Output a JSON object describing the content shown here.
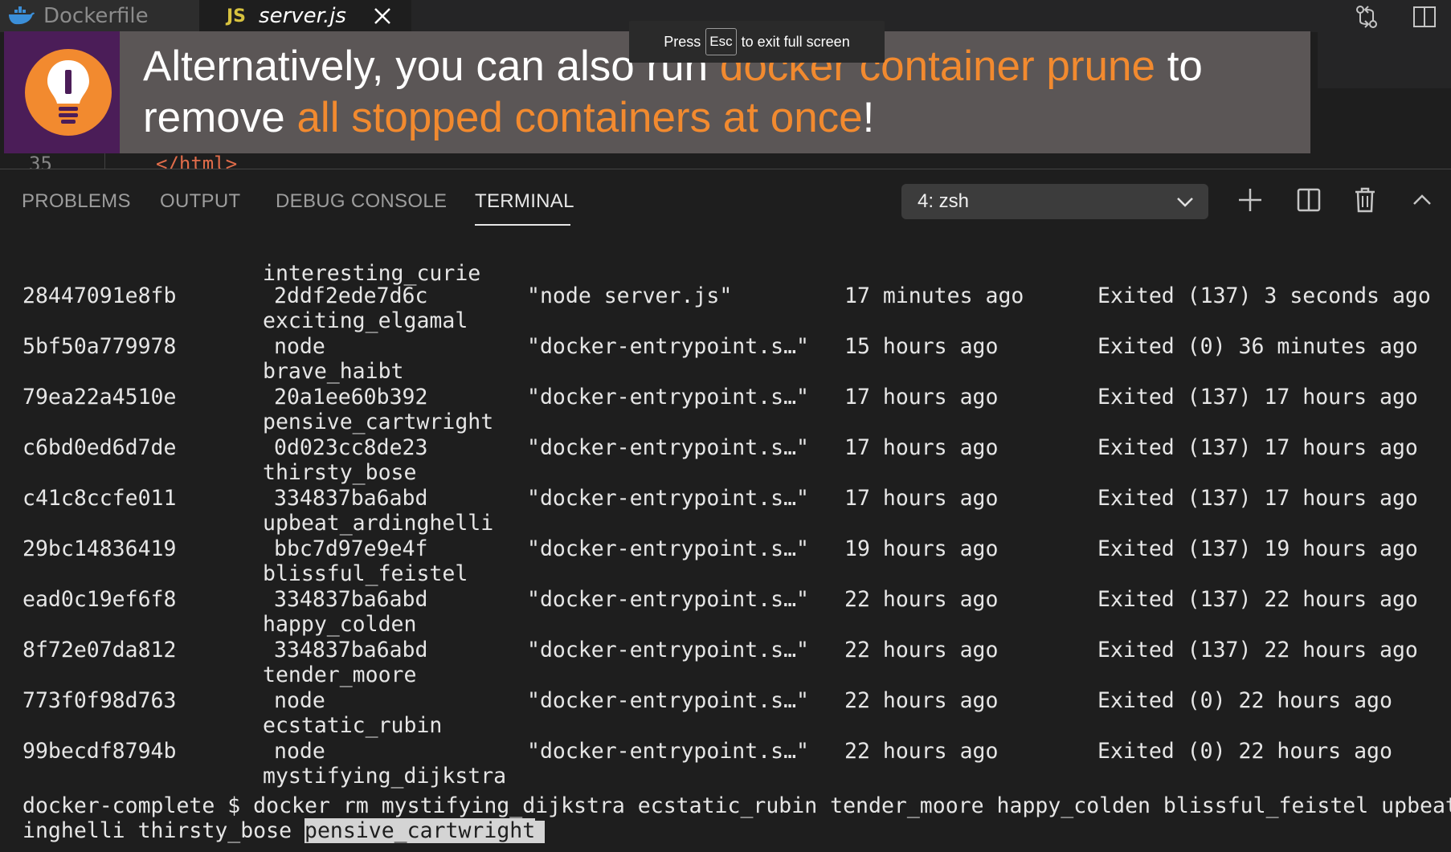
{
  "tabs": [
    {
      "label": "Dockerfile",
      "icon": "docker-whale-icon"
    },
    {
      "label": "server.js",
      "badge": "JS",
      "icon": "javascript-icon"
    }
  ],
  "editor": {
    "line_number": "35",
    "code": "</html>"
  },
  "banner": {
    "icon": "lightbulb-icon",
    "t1": "Alternatively, you can also run ",
    "h1": "docker container prune",
    "t2": " to remove ",
    "h2": "all stopped containers at once",
    "t3": "!"
  },
  "fullscreen_hint": {
    "before": "Press",
    "key": "Esc",
    "after": "to exit full screen"
  },
  "panel": {
    "tabs": [
      "PROBLEMS",
      "OUTPUT",
      "DEBUG CONSOLE",
      "TERMINAL"
    ],
    "active_tab": "TERMINAL",
    "terminal_select": "4: zsh"
  },
  "terminal": {
    "first_name": "interesting_curie",
    "rows": [
      {
        "id": "28447091e8fb",
        "image": "2ddf2ede7d6c",
        "command": "\"node server.js\"",
        "created": "17 minutes ago",
        "status": "Exited (137) 3 seconds ago",
        "name": "exciting_elgamal"
      },
      {
        "id": "5bf50a779978",
        "image": "node",
        "command": "\"docker-entrypoint.s…\"",
        "created": "15 hours ago",
        "status": "Exited (0) 36 minutes ago",
        "name": "brave_haibt"
      },
      {
        "id": "79ea22a4510e",
        "image": "20a1ee60b392",
        "command": "\"docker-entrypoint.s…\"",
        "created": "17 hours ago",
        "status": "Exited (137) 17 hours ago",
        "name": "pensive_cartwright"
      },
      {
        "id": "c6bd0ed6d7de",
        "image": "0d023cc8de23",
        "command": "\"docker-entrypoint.s…\"",
        "created": "17 hours ago",
        "status": "Exited (137) 17 hours ago",
        "name": "thirsty_bose"
      },
      {
        "id": "c41c8ccfe011",
        "image": "334837ba6abd",
        "command": "\"docker-entrypoint.s…\"",
        "created": "17 hours ago",
        "status": "Exited (137) 17 hours ago",
        "name": "upbeat_ardinghelli"
      },
      {
        "id": "29bc14836419",
        "image": "bbc7d97e9e4f",
        "command": "\"docker-entrypoint.s…\"",
        "created": "19 hours ago",
        "status": "Exited (137) 19 hours ago",
        "name": "blissful_feistel"
      },
      {
        "id": "ead0c19ef6f8",
        "image": "334837ba6abd",
        "command": "\"docker-entrypoint.s…\"",
        "created": "22 hours ago",
        "status": "Exited (137) 22 hours ago",
        "name": "happy_colden"
      },
      {
        "id": "8f72e07da812",
        "image": "334837ba6abd",
        "command": "\"docker-entrypoint.s…\"",
        "created": "22 hours ago",
        "status": "Exited (137) 22 hours ago",
        "name": "tender_moore"
      },
      {
        "id": "773f0f98d763",
        "image": "node",
        "command": "\"docker-entrypoint.s…\"",
        "created": "22 hours ago",
        "status": "Exited (0) 22 hours ago",
        "name": "ecstatic_rubin"
      },
      {
        "id": "99becdf8794b",
        "image": "node",
        "command": "\"docker-entrypoint.s…\"",
        "created": "22 hours ago",
        "status": "Exited (0) 22 hours ago",
        "name": "mystifying_dijkstra"
      }
    ],
    "prompt_line": "docker-complete $ docker rm mystifying_dijkstra ecstatic_rubin tender_moore happy_colden blissful_feistel upbeat_",
    "prompt_cont": "inghelli thirsty_bose ",
    "selected_word": "pensive_cartwright"
  }
}
